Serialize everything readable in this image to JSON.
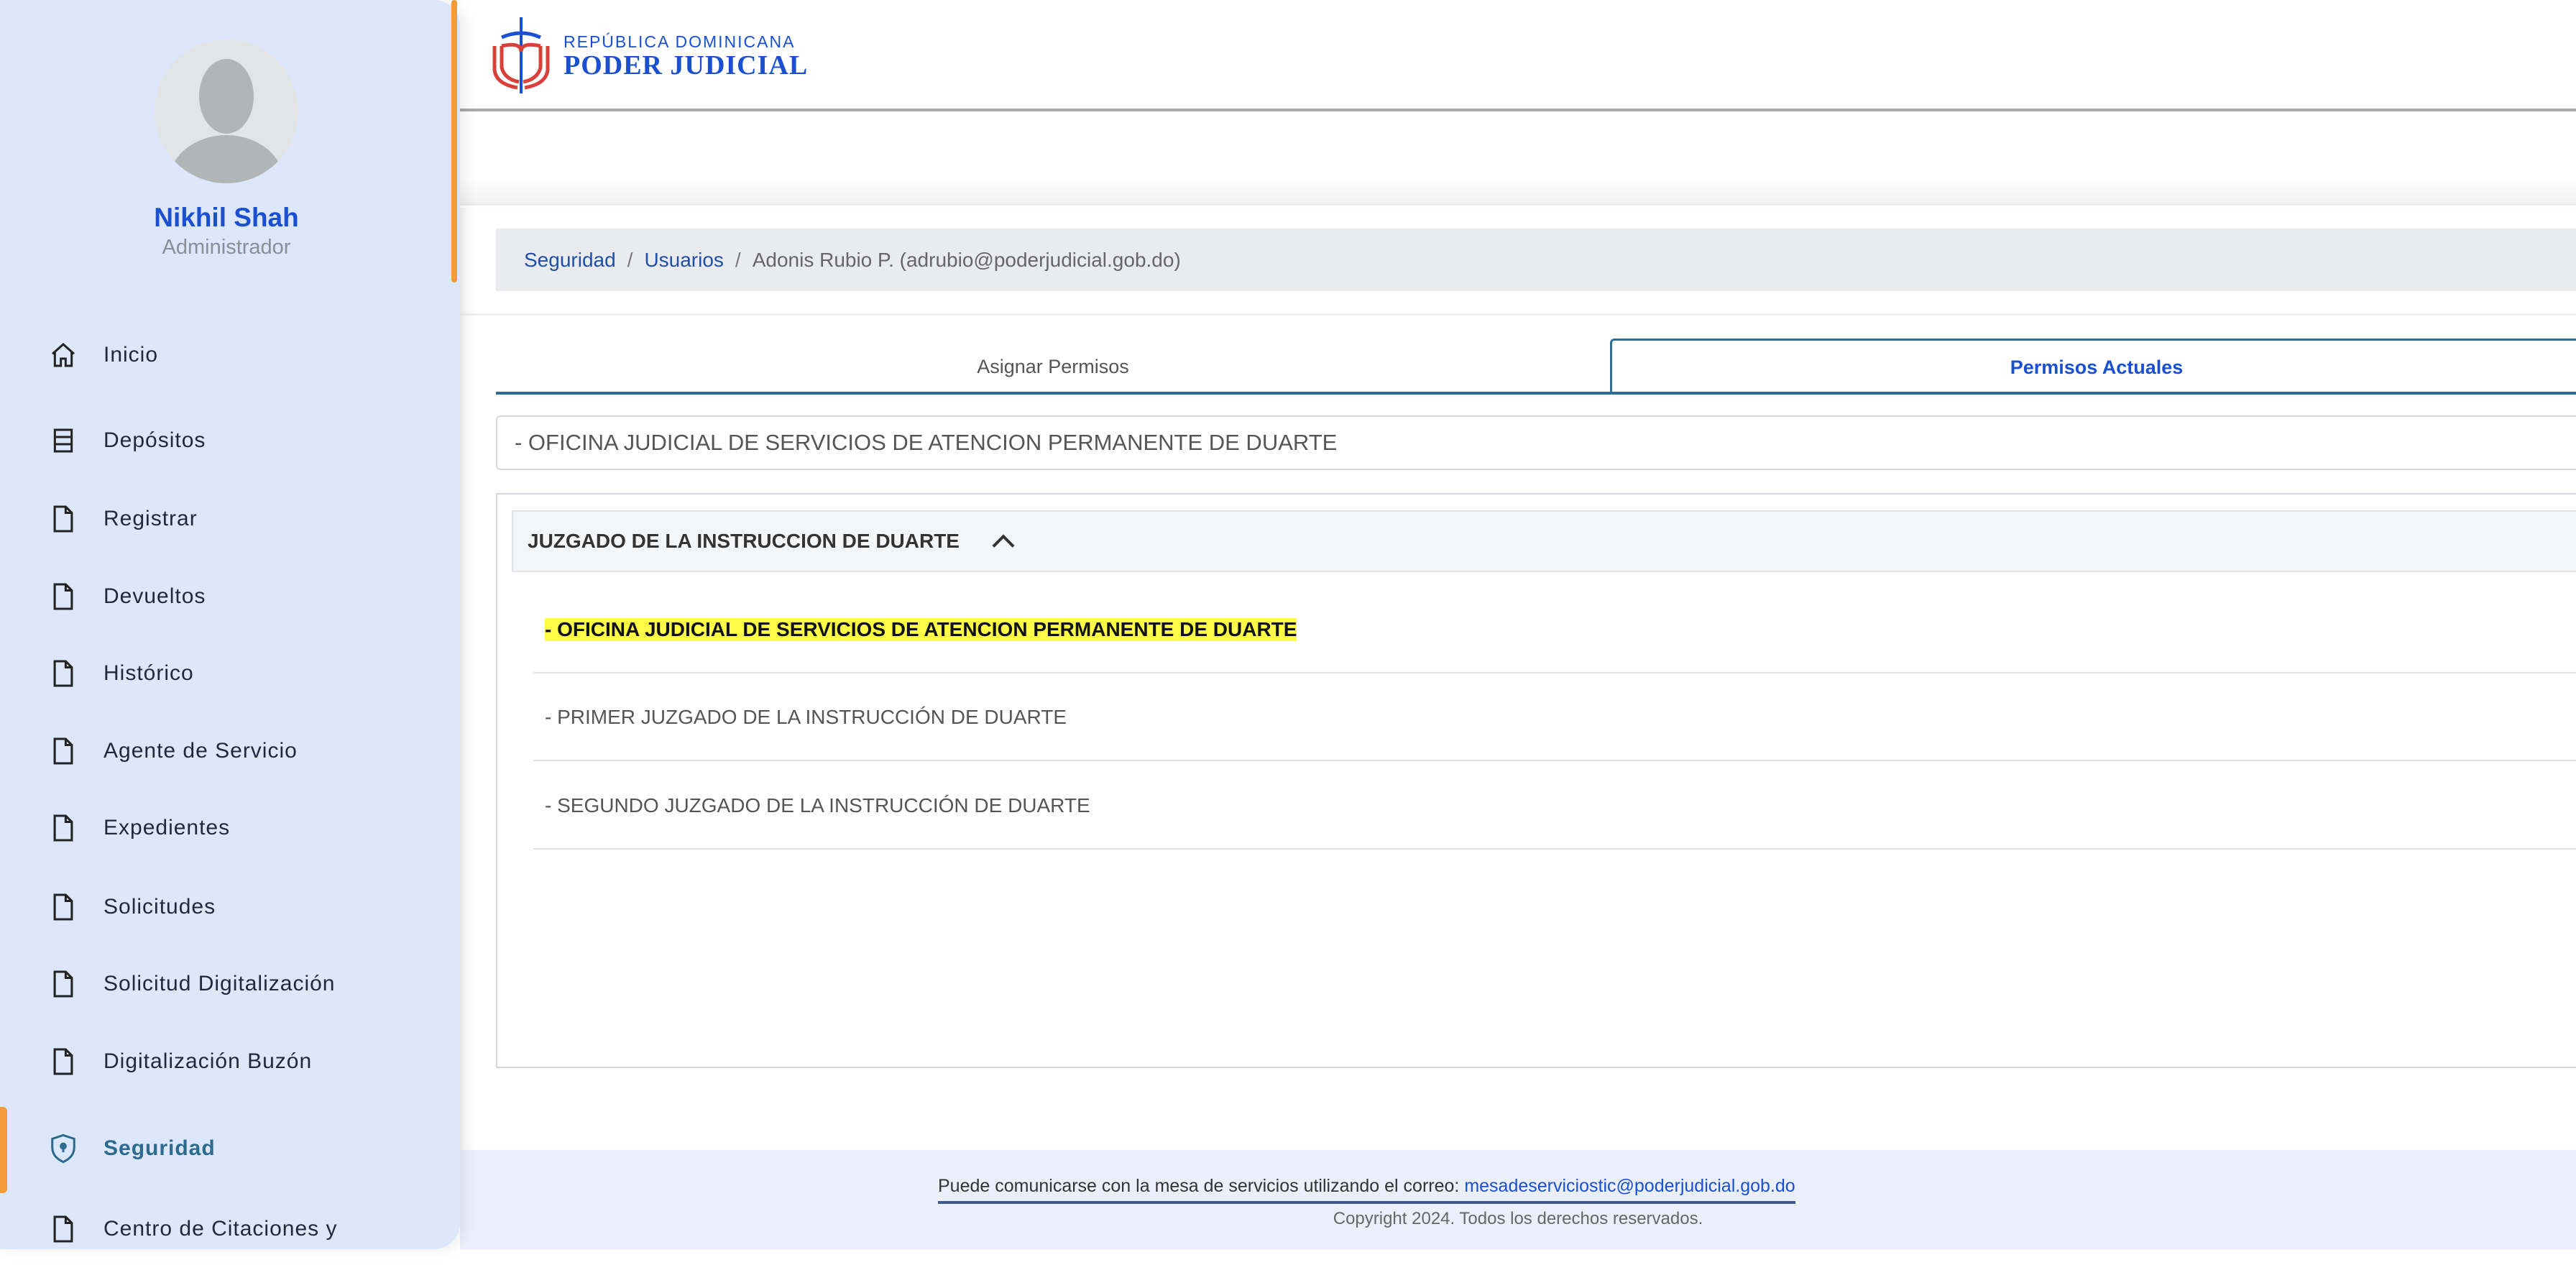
{
  "user": {
    "name": "Nikhil Shah",
    "role": "Administrador"
  },
  "sidebar": {
    "items": [
      {
        "label": "Inicio",
        "icon": "home-icon"
      },
      {
        "label": "Depósitos",
        "icon": "list-icon"
      },
      {
        "label": "Registrar",
        "icon": "file-icon"
      },
      {
        "label": "Devueltos",
        "icon": "file-icon"
      },
      {
        "label": "Histórico",
        "icon": "file-icon"
      },
      {
        "label": "Agente de Servicio",
        "icon": "file-icon"
      },
      {
        "label": "Expedientes",
        "icon": "file-icon"
      },
      {
        "label": "Solicitudes",
        "icon": "file-icon"
      },
      {
        "label": "Solicitud Digitalización",
        "icon": "file-icon"
      },
      {
        "label": "Digitalización Buzón",
        "icon": "file-icon"
      },
      {
        "label": "Seguridad",
        "icon": "shield-icon",
        "active": true
      },
      {
        "label": "Centro de Citaciones y",
        "icon": "file-icon"
      }
    ]
  },
  "logo": {
    "line1": "REPÚBLICA DOMINICANA",
    "line2": "PODER JUDICIAL"
  },
  "breadcrumb": {
    "items": [
      "Seguridad",
      "Usuarios"
    ],
    "current": "Adonis Rubio P. (adrubio@poderjudicial.gob.do)",
    "sep": "/"
  },
  "tabs": [
    "Asignar Permisos",
    "Permisos Actuales"
  ],
  "select": {
    "value": "- OFICINA JUDICIAL DE SERVICIOS DE ATENCION PERMANENTE DE DUARTE"
  },
  "accordion": {
    "title": "JUZGADO DE LA INSTRUCCION DE DUARTE",
    "items": [
      "- OFICINA JUDICIAL DE SERVICIOS DE ATENCION PERMANENTE DE DUARTE",
      "- PRIMER JUZGADO DE LA INSTRUCCIÓN DE DUARTE",
      "- SEGUNDO JUZGADO DE LA INSTRUCCIÓN DE DUARTE"
    ]
  },
  "footer": {
    "contact": "Puede comunicarse con la mesa de servicios utilizando el correo:",
    "email": "mesadeserviciostic@poderjudicial.gob.do",
    "copyright": "Copyright 2024. Todos los derechos reservados."
  },
  "colors": {
    "accent": "#1a4fd0",
    "active": "#f39b38",
    "highlight": "#fdfc47"
  }
}
